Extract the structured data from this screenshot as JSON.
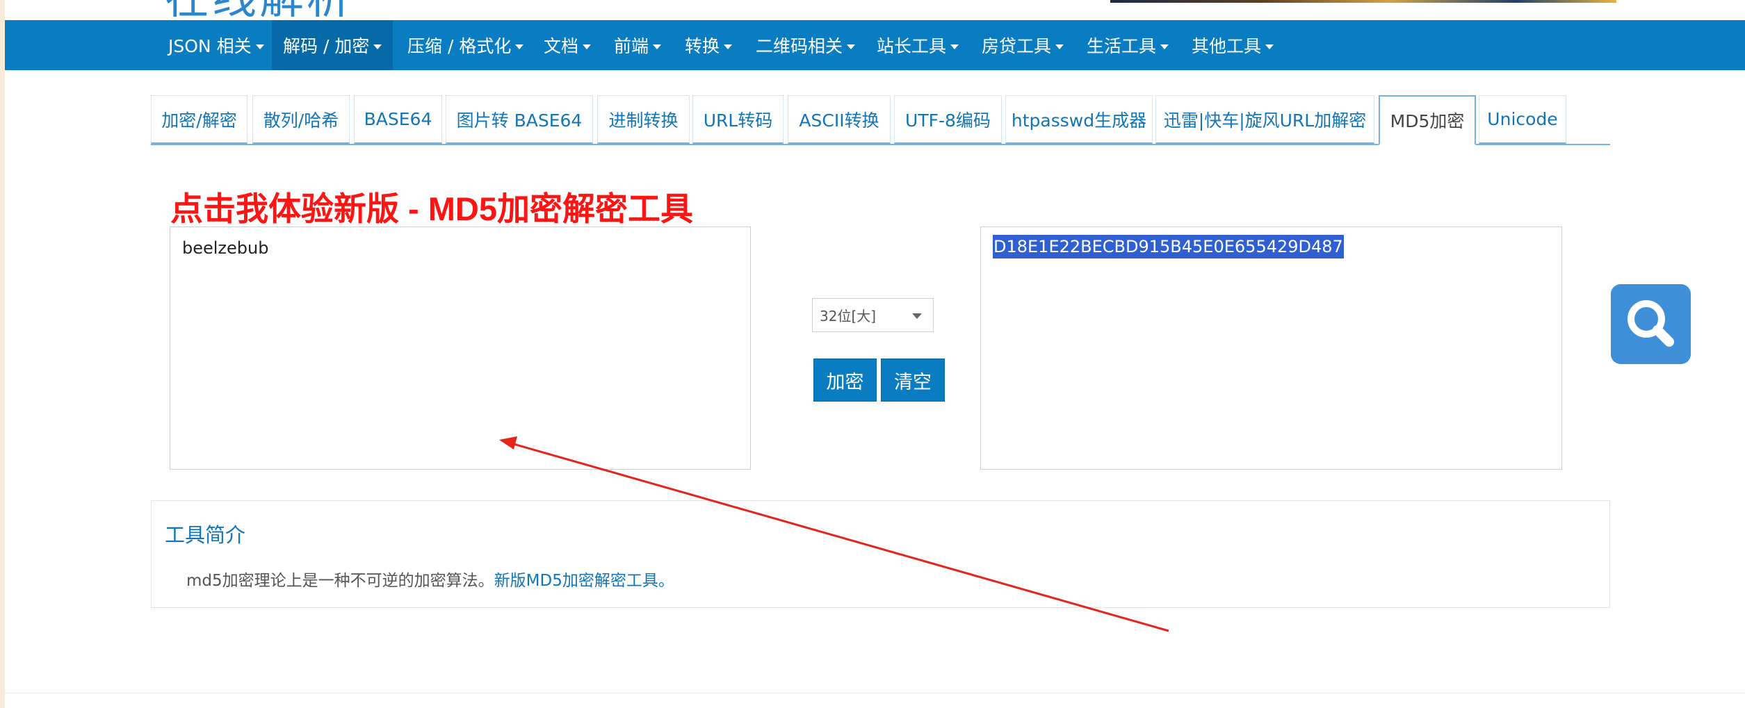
{
  "header": {
    "logo_text": "在线解析"
  },
  "nav": {
    "items": [
      {
        "label": "JSON 相关"
      },
      {
        "label": "解码 / 加密"
      },
      {
        "label": "压缩 / 格式化"
      },
      {
        "label": "文档"
      },
      {
        "label": "前端"
      },
      {
        "label": "转换"
      },
      {
        "label": "二维码相关"
      },
      {
        "label": "站长工具"
      },
      {
        "label": "房贷工具"
      },
      {
        "label": "生活工具"
      },
      {
        "label": "其他工具"
      }
    ],
    "active_index": 1
  },
  "tabs": {
    "items": [
      {
        "label": "加密/解密"
      },
      {
        "label": "散列/哈希"
      },
      {
        "label": "BASE64"
      },
      {
        "label": "图片转 BASE64"
      },
      {
        "label": "进制转换"
      },
      {
        "label": "URL转码"
      },
      {
        "label": "ASCII转换"
      },
      {
        "label": "UTF-8编码"
      },
      {
        "label": "htpasswd生成器"
      },
      {
        "label": "迅雷|快车|旋风URL加解密"
      },
      {
        "label": "MD5加密"
      },
      {
        "label": "Unicode"
      }
    ],
    "active_index": 10
  },
  "promo": {
    "text": "点击我体验新版 - MD5加密解密工具"
  },
  "tool": {
    "input_value": "beelzebub",
    "output_value": "D18E1E22BECBD915B45E0E655429D487",
    "bits_select": "32位[大]",
    "encrypt_label": "加密",
    "clear_label": "清空"
  },
  "intro": {
    "title": "工具简介",
    "text": "md5加密理论上是一种不可逆的加密算法。",
    "link_text": "新版MD5加密解密工具。"
  },
  "colors": {
    "nav_bg": "#0a7cc2",
    "nav_active_bg": "#066aa8",
    "link": "#1275b8",
    "promo": "#ff1414",
    "selection": "#2f5fd0",
    "annotation_arrow": "#e8231c",
    "search_fab": "#3f8fd8"
  },
  "icons": {
    "search_fab": "search-icon",
    "dropdown": "caret-down-icon",
    "annotation": "arrow-annotation"
  }
}
